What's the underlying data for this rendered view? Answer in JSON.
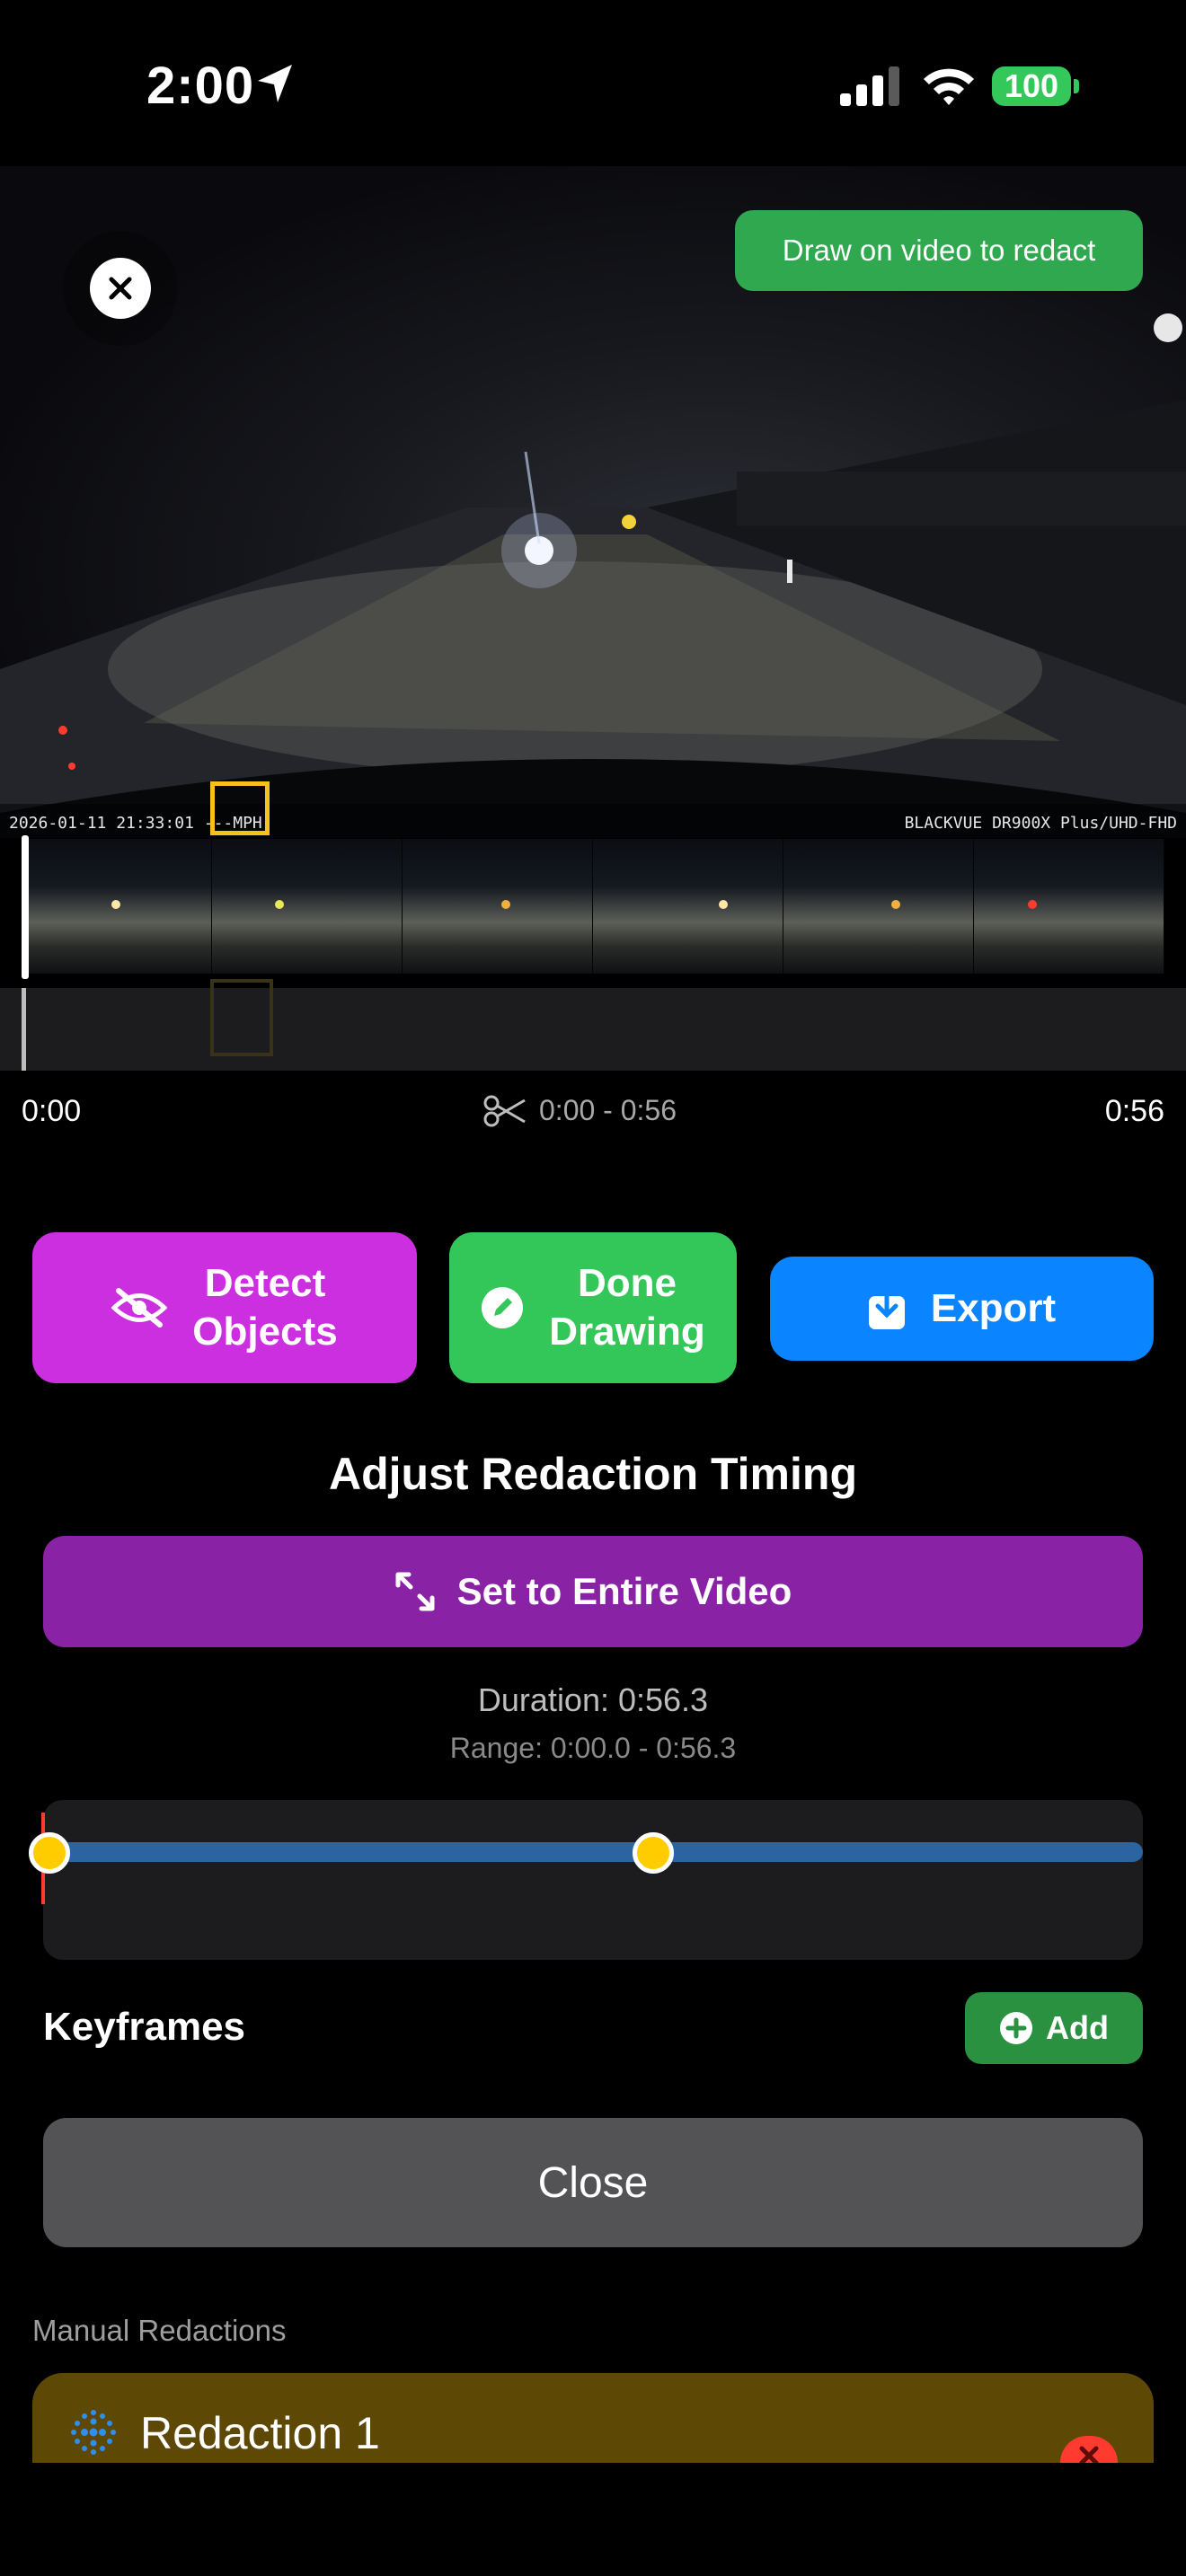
{
  "status_bar": {
    "time": "2:00",
    "battery": "100"
  },
  "video": {
    "hint": "Draw on video to redact",
    "overlay_left": "2026-01-11 21:33:01 ---MPH",
    "overlay_right": "BLACKVUE DR900X Plus/UHD-FHD"
  },
  "timeline": {
    "start": "0:00",
    "end": "0:56",
    "range": "0:00 - 0:56"
  },
  "actions": {
    "detect_line1": "Detect",
    "detect_line2": "Objects",
    "done_line1": "Done",
    "done_line2": "Drawing",
    "export": "Export"
  },
  "timing": {
    "title": "Adjust Redaction Timing",
    "set_entire": "Set to Entire Video",
    "duration": "Duration: 0:56.3",
    "range": "Range: 0:00.0 - 0:56.3"
  },
  "keyframes": {
    "label": "Keyframes",
    "add": "Add"
  },
  "close_label": "Close",
  "manual": {
    "section_label": "Manual Redactions",
    "items": [
      {
        "title": "Redaction 1"
      }
    ]
  },
  "colors": {
    "detect": "#cc2fe0",
    "done": "#33c759",
    "export": "#0a84ff",
    "entire": "#8a22a6",
    "track": "#2b64a0",
    "knob": "#ffcc00",
    "card": "#5e4806"
  }
}
